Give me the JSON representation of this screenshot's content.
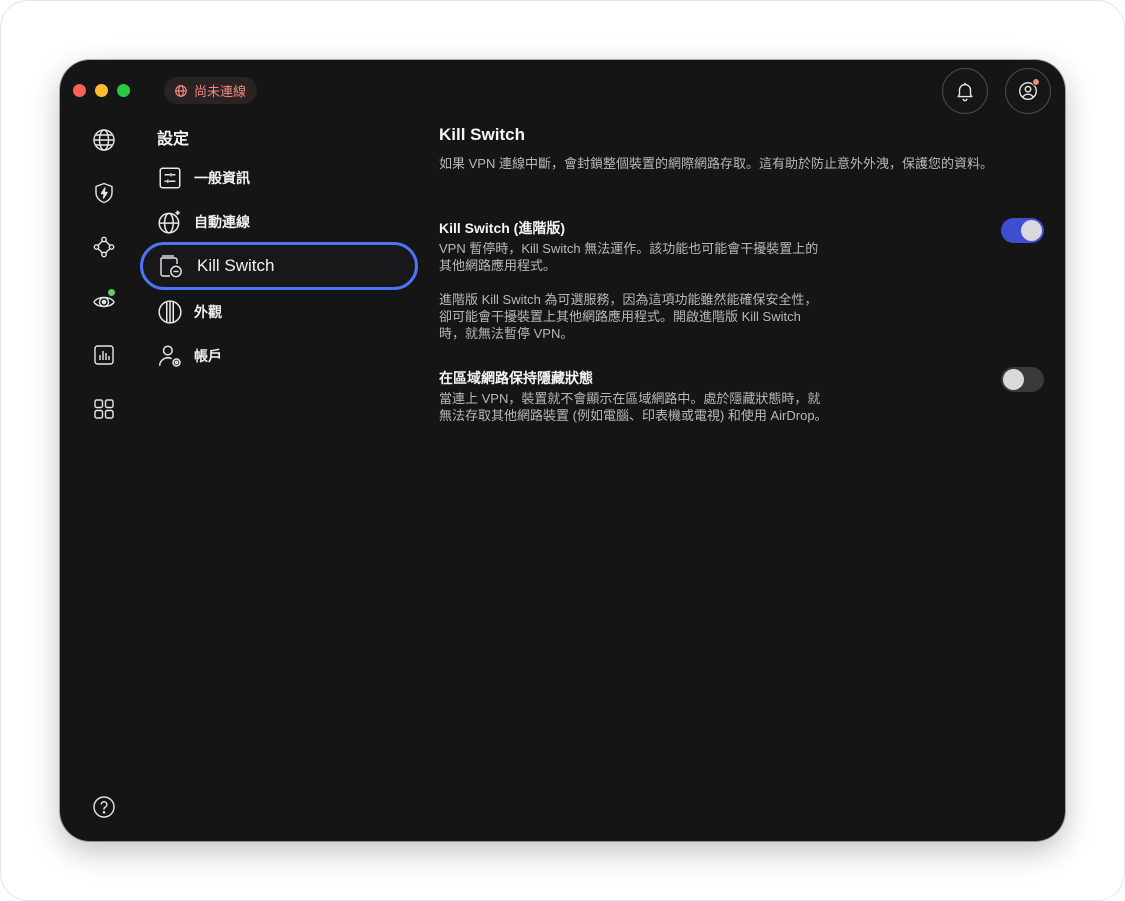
{
  "status": {
    "label": "尚未連線",
    "color": "#f08a7e"
  },
  "toolbar": {
    "bell_icon": "bell-icon",
    "account_icon": "account-icon"
  },
  "rail": {
    "items": [
      {
        "name": "globe-icon"
      },
      {
        "name": "shield-bolt-icon"
      },
      {
        "name": "network-icon"
      },
      {
        "name": "radar-icon",
        "badge": true
      },
      {
        "name": "stats-icon"
      },
      {
        "name": "grid-icon"
      }
    ],
    "help": "help-icon"
  },
  "menu": {
    "title": "設定",
    "items": [
      {
        "label": "一般資訊",
        "icon": "sliders-icon",
        "active": false
      },
      {
        "label": "自動連線",
        "icon": "globe-sparkle-icon",
        "active": false
      },
      {
        "label": "Kill Switch",
        "icon": "kill-switch-icon",
        "active": true
      },
      {
        "label": "外觀",
        "icon": "appearance-icon",
        "active": false
      },
      {
        "label": "帳戶",
        "icon": "account-settings-icon",
        "active": false
      }
    ]
  },
  "content": {
    "title": "Kill Switch",
    "description": "如果 VPN 連線中斷，會封鎖整個裝置的網際網路存取。這有助於防止意外外洩，保護您的資料。",
    "advanced": {
      "title": "Kill Switch (進階版)",
      "desc1": "VPN 暫停時，Kill Switch 無法運作。該功能也可能會干擾裝置上的其他網路應用程式。",
      "desc2": "進階版 Kill Switch 為可選服務，因為這項功能雖然能確保安全性，卻可能會干擾裝置上其他網路應用程式。開啟進階版 Kill Switch 時，就無法暫停 VPN。",
      "enabled": true
    },
    "stealth": {
      "title": "在區域網路保持隱藏狀態",
      "desc": "當連上 VPN，裝置就不會顯示在區域網路中。處於隱藏狀態時，就無法存取其他網路裝置 (例如電腦、印表機或電視) 和使用 AirDrop。",
      "enabled": false
    }
  },
  "colors": {
    "accent": "#4d74f5",
    "toggle_on": "#3e4ed0",
    "background": "#151516"
  }
}
